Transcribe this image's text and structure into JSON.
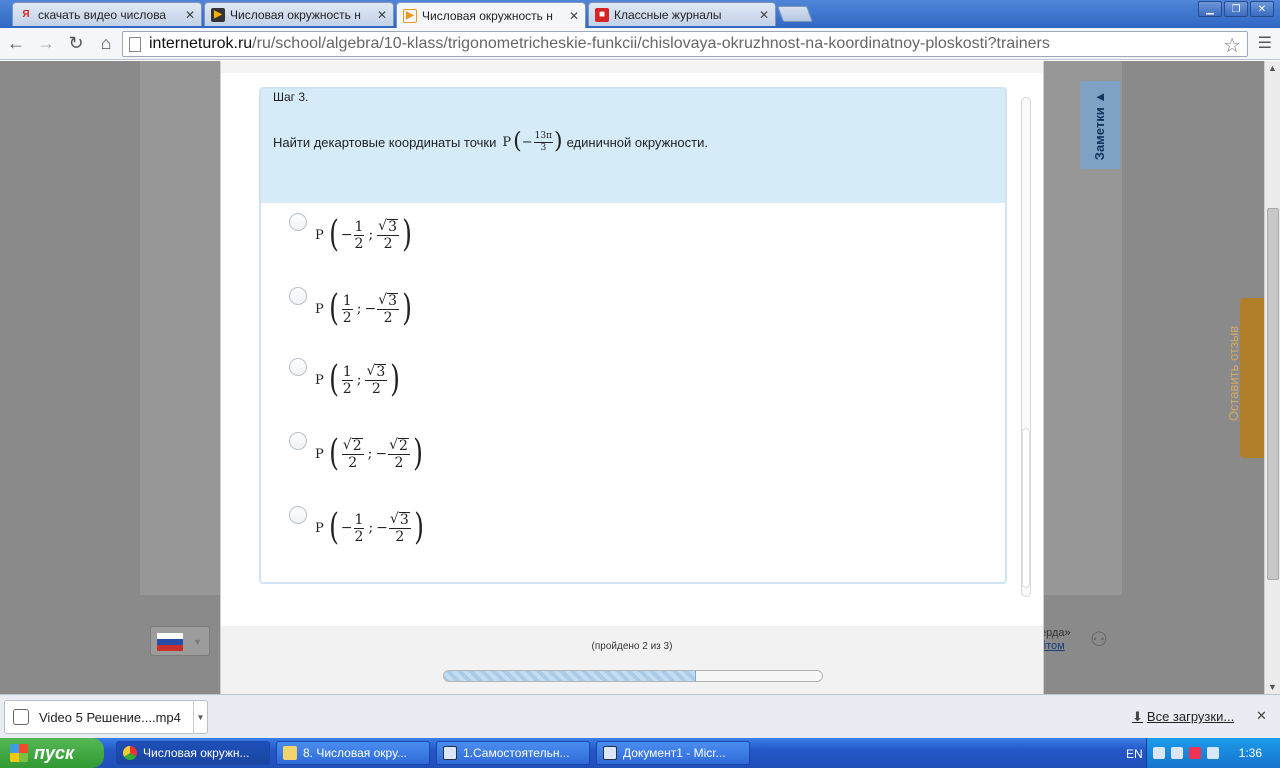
{
  "browser": {
    "tabs": [
      {
        "label": "скачать видео числова",
        "icon": "yandex-icon",
        "active": false
      },
      {
        "label": "Числовая окружность н",
        "icon": "video-icon",
        "active": false
      },
      {
        "label": "Числовая окружность н",
        "icon": "interneturok-icon",
        "active": true
      },
      {
        "label": "Классные журналы",
        "icon": "journal-icon",
        "active": false
      }
    ],
    "url_host": "interneturok.ru",
    "url_path": "/ru/school/algebra/10-klass/trigonometricheskie-funkcii/chislovaya-okruzhnost-na-koordinatnoy-ploskosti?trainers"
  },
  "page": {
    "notes_tab": "Заметки ▲",
    "feedback_tab": "Оставить отзыв",
    "footnote_line1": "ерда»",
    "footnote_line2": "йтом"
  },
  "trainer": {
    "step": "Шаг 3.",
    "task_before": "Найти декартовые координаты  точки",
    "task_point": "P",
    "task_num": "13π",
    "task_den": "3",
    "task_sign": "−",
    "task_after": "единичной окружности.",
    "options": [
      {
        "x_sign": "−",
        "x_num": "1",
        "x_den": "2",
        "x_root": false,
        "y_sign": "",
        "y_num": "3",
        "y_den": "2",
        "y_root": true
      },
      {
        "x_sign": "",
        "x_num": "1",
        "x_den": "2",
        "x_root": false,
        "y_sign": "−",
        "y_num": "3",
        "y_den": "2",
        "y_root": true
      },
      {
        "x_sign": "",
        "x_num": "1",
        "x_den": "2",
        "x_root": false,
        "y_sign": "",
        "y_num": "3",
        "y_den": "2",
        "y_root": true
      },
      {
        "x_sign": "",
        "x_num": "2",
        "x_den": "2",
        "x_root": true,
        "y_sign": "−",
        "y_num": "2",
        "y_den": "2",
        "y_root": true
      },
      {
        "x_sign": "−",
        "x_num": "1",
        "x_den": "2",
        "x_root": false,
        "y_sign": "−",
        "y_num": "3",
        "y_den": "2",
        "y_root": true
      }
    ],
    "passed_text": "(пройдено 2 из 3)",
    "progress_fraction": 0.667
  },
  "downloads": {
    "item": "Video 5 Решение....mp4",
    "all_label": "Все загрузки..."
  },
  "taskbar": {
    "start_label": "пуск",
    "buttons": [
      {
        "label": "Числовая окружн...",
        "active": true
      },
      {
        "label": "8. Числовая окру...",
        "active": false
      },
      {
        "label": "1.Самостоятельн...",
        "active": false
      },
      {
        "label": "Документ1 - Micr...",
        "active": false
      }
    ],
    "lang": "EN",
    "clock": "1:36"
  },
  "colors": {
    "header_bg": "#d6ebf8",
    "card_border": "#cfe3f2",
    "overlay": "#8a8a8a",
    "feedback": "#b17e29"
  }
}
